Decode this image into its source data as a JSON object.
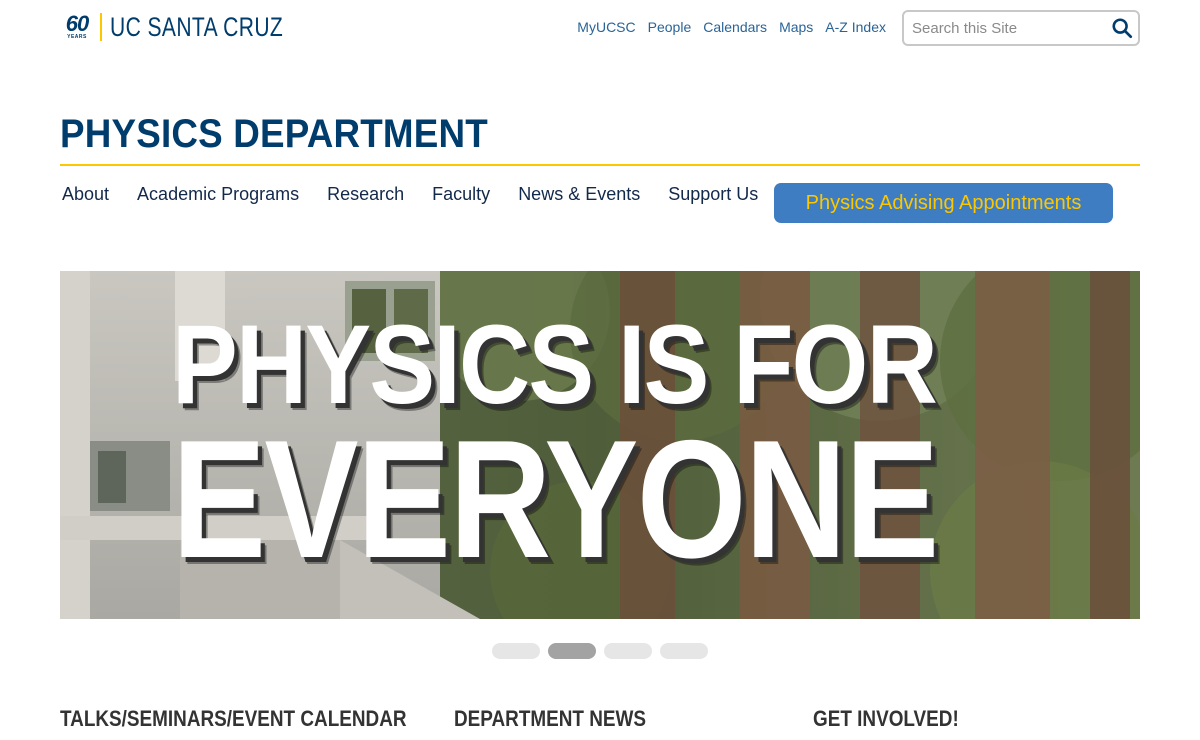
{
  "logo": {
    "number": "60",
    "years": "YEARS",
    "name": "UC SANTA CRUZ"
  },
  "utility_links": [
    "MyUCSC",
    "People",
    "Calendars",
    "Maps",
    "A-Z Index"
  ],
  "search": {
    "placeholder": "Search this Site",
    "value": ""
  },
  "department": {
    "title": "PHYSICS DEPARTMENT"
  },
  "nav": {
    "items": [
      "About",
      "Academic Programs",
      "Research",
      "Faculty",
      "News & Events",
      "Support Us"
    ],
    "cta": "Physics Advising Appointments"
  },
  "hero": {
    "line1": "PHYSICS IS FOR",
    "line2": "EVERYONE"
  },
  "carousel": {
    "slides": 4,
    "active_index": 1
  },
  "sections": [
    "TALKS/SEMINARS/EVENT CALENDAR",
    "DEPARTMENT NEWS",
    "GET INVOLVED!"
  ],
  "colors": {
    "brand_blue": "#003c6c",
    "gold": "#fdc700",
    "button_blue": "#3e7dc2",
    "link": "#2a6496"
  }
}
